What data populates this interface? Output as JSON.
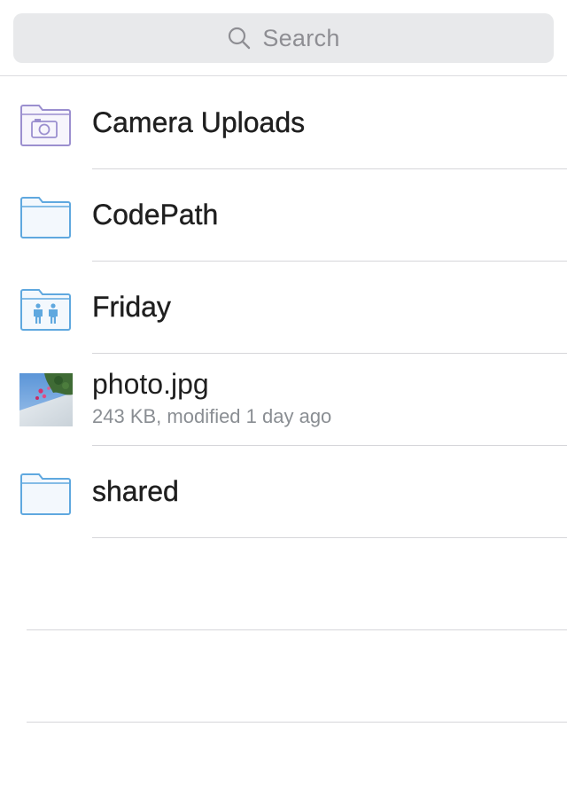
{
  "search": {
    "placeholder": "Search",
    "icon": "search-icon"
  },
  "items": [
    {
      "type": "folder",
      "variant": "camera",
      "name": "Camera Uploads",
      "icon": "camera-folder-icon"
    },
    {
      "type": "folder",
      "variant": "plain",
      "name": "CodePath",
      "icon": "folder-icon"
    },
    {
      "type": "folder",
      "variant": "shared",
      "name": "Friday",
      "icon": "shared-folder-icon"
    },
    {
      "type": "file",
      "name": "photo.jpg",
      "details": "243 KB, modified 1 day ago",
      "icon": "photo-thumbnail"
    },
    {
      "type": "folder",
      "variant": "plain",
      "name": "shared",
      "icon": "folder-icon"
    }
  ],
  "colors": {
    "folder_blue": "#5fa8df",
    "folder_fill": "#f3f8fd",
    "camera_purple": "#9b8fcf",
    "camera_fill": "#f7f5fc",
    "separator": "#d6d6da",
    "search_bg": "#e8e9eb",
    "subtitle": "#8a8e93"
  }
}
